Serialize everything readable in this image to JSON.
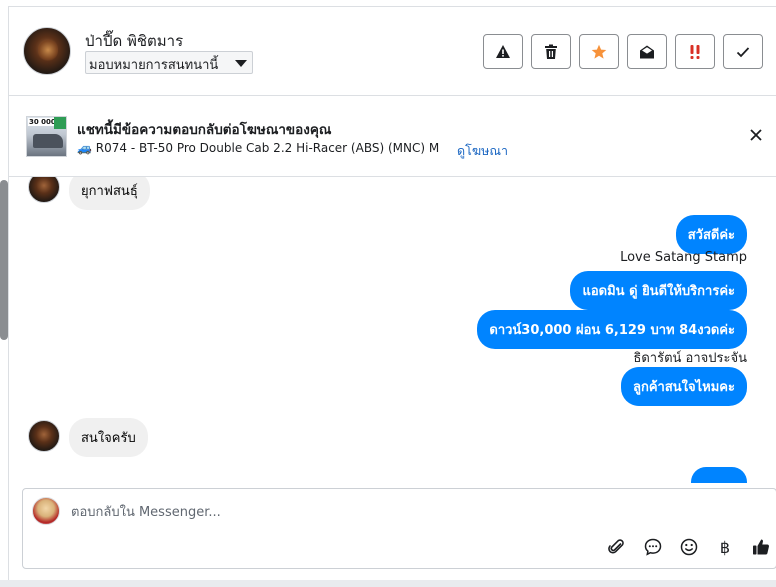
{
  "header": {
    "user_name": "ป่าปี๊ด พิชิตมาร",
    "assign_value": "มอบหมายการสนทนานี้",
    "actions": [
      {
        "name": "spam-icon",
        "color": "#1c1e21"
      },
      {
        "name": "trash-icon",
        "color": "#1c1e21"
      },
      {
        "name": "star-icon",
        "color": "#f7923a"
      },
      {
        "name": "envelope-open-icon",
        "color": "#1c1e21"
      },
      {
        "name": "priority-icon",
        "color": "#d93025"
      },
      {
        "name": "check-icon",
        "color": "#1c1e21"
      }
    ]
  },
  "ad": {
    "thumb_price": "30 000",
    "title": "แชทนี้มีข้อความตอบกลับต่อโฆษณาของคุณ",
    "line": "🚙 R074 - BT-50 Pro Double Cab 2.2 Hi-Racer (ABS) (MNC) MT ...",
    "link": "ดูโฆษณา"
  },
  "messages": {
    "in_1": "ยุกาฟสนธุ์",
    "out_1": "สวัสดีค่ะ",
    "sender_1": "Love Satang Stamp",
    "out_2": "แอดมิน ดู่ ยินดีให้บริการค่ะ",
    "out_3": "ดาวน์30,000 ผ่อน 6,129 บาท 84งวดค่ะ",
    "sender_2": "ธิดารัตน์ อาจประจัน",
    "out_4": "ลูกค้าสนใจไหมคะ",
    "in_2": "สนใจครับ"
  },
  "composer": {
    "placeholder": "ตอบกลับใน Messenger...",
    "baht_symbol": "฿"
  },
  "colors": {
    "accent": "#0084ff",
    "link": "#1a66c2"
  }
}
